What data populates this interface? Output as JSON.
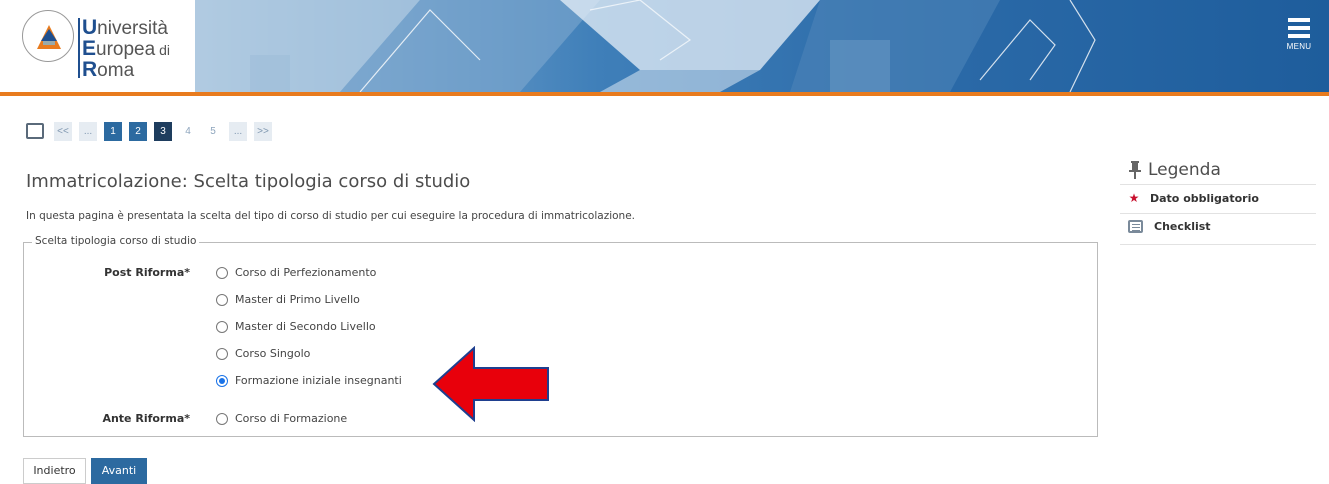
{
  "header": {
    "logo": {
      "line1_initial": "U",
      "line1_rest": "niversità",
      "line2_initial": "E",
      "line2_rest": "uropea",
      "line2_suffix": " di",
      "line3_initial": "R",
      "line3_rest": "oma",
      "seal_text": "IN BONO MALUM VINCE"
    },
    "menu_label": "MENU",
    "accent_color": "#e87b1e"
  },
  "pager": {
    "list_icon": "list-icon",
    "items": [
      {
        "label": "<<",
        "state": "box"
      },
      {
        "label": "...",
        "state": "box"
      },
      {
        "label": "1",
        "state": "act"
      },
      {
        "label": "2",
        "state": "act"
      },
      {
        "label": "3",
        "state": "cur"
      },
      {
        "label": "4",
        "state": "plain"
      },
      {
        "label": "5",
        "state": "plain"
      },
      {
        "label": "...",
        "state": "box"
      },
      {
        "label": ">>",
        "state": "box"
      }
    ]
  },
  "page": {
    "title": "Immatricolazione: Scelta tipologia corso di studio",
    "intro": "In questa pagina è presentata la scelta del tipo di corso di studio per cui eseguire la procedura di immatricolazione."
  },
  "form": {
    "legend": "Scelta tipologia corso di studio",
    "post_label": "Post Riforma*",
    "ante_label": "Ante Riforma*",
    "options": [
      "Corso di Perfezionamento",
      "Master di Primo Livello",
      "Master di Secondo Livello",
      "Corso Singolo",
      "Formazione iniziale insegnanti",
      "Corso di Formazione"
    ],
    "selected": "Formazione iniziale insegnanti"
  },
  "buttons": {
    "back": "Indietro",
    "next": "Avanti"
  },
  "legenda": {
    "title": "Legenda",
    "items": [
      {
        "icon": "star-icon",
        "label": "Dato obbligatorio"
      },
      {
        "icon": "checklist-icon",
        "label": "Checklist"
      }
    ]
  },
  "annotation": {
    "arrow_color": "#e8000b",
    "arrow_stroke": "#1f3f8f"
  }
}
